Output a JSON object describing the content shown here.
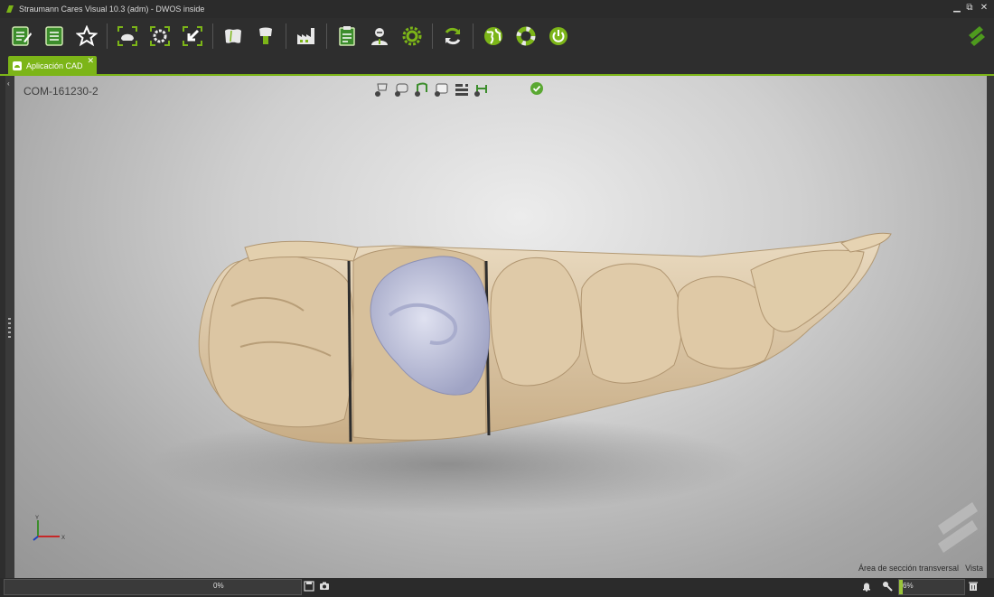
{
  "window": {
    "title": "Straumann Cares Visual 10.3  (adm) - DWOS inside",
    "controls": {
      "minimize": "▁",
      "restore": "⧉",
      "close": "✕"
    }
  },
  "toolbar": {
    "buttons": [
      {
        "name": "edit-order-icon"
      },
      {
        "name": "order-list-icon"
      },
      {
        "name": "favorite-star-icon"
      },
      {
        "name": "scan-model-icon"
      },
      {
        "name": "scan-arch-icon"
      },
      {
        "name": "import-arrow-icon"
      },
      {
        "name": "crown-design-icon"
      },
      {
        "name": "abutment-icon"
      },
      {
        "name": "production-factory-icon"
      },
      {
        "name": "report-clipboard-icon"
      },
      {
        "name": "doctor-avatar-icon"
      },
      {
        "name": "settings-gear-icon"
      },
      {
        "name": "sync-refresh-icon"
      },
      {
        "name": "web-globe-icon"
      },
      {
        "name": "help-lifebuoy-icon"
      },
      {
        "name": "power-icon"
      }
    ]
  },
  "tab": {
    "label": "Aplicación CAD",
    "close": "✕"
  },
  "viewport": {
    "case_id": "COM-161230-2",
    "axes": {
      "y": "Y",
      "x": "X"
    },
    "status_left": "Área de sección transversal",
    "status_right": "Vista"
  },
  "statusbar": {
    "left_progress": 0,
    "left_progress_label": "0%",
    "right_progress": 0.06,
    "right_progress_label": "6%"
  },
  "colors": {
    "accent": "#7cb518",
    "tooth": "#d9c4a4",
    "crown": "#b9bcd6"
  }
}
